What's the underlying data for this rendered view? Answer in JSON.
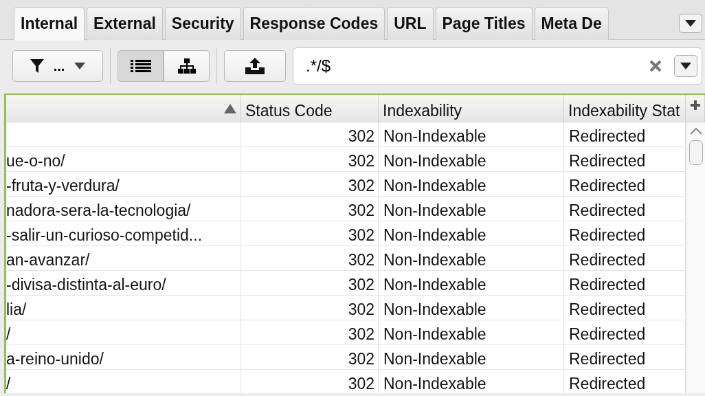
{
  "tabs": [
    {
      "label": "Internal",
      "selected": true
    },
    {
      "label": "External",
      "selected": false
    },
    {
      "label": "Security",
      "selected": false
    },
    {
      "label": "Response Codes",
      "selected": false
    },
    {
      "label": "URL",
      "selected": false
    },
    {
      "label": "Page Titles",
      "selected": false
    },
    {
      "label": "Meta De",
      "selected": false
    }
  ],
  "toolbar": {
    "filter_label": "...",
    "view_modes": [
      {
        "kind": "list",
        "selected": true
      },
      {
        "kind": "tree",
        "selected": false
      }
    ],
    "search": {
      "value": ".*/$"
    }
  },
  "table": {
    "columns": [
      {
        "sort_ascending": true
      },
      {
        "label": "Status Code"
      },
      {
        "label": "Indexability"
      },
      {
        "label": "Indexability Stat"
      }
    ],
    "rows": [
      {
        "status_code": "302",
        "indexability": "Non-Indexable",
        "indexability_status": "Redirected"
      },
      {
        "url": "ue-o-no/",
        "status_code": "302",
        "indexability": "Non-Indexable",
        "indexability_status": "Redirected"
      },
      {
        "url": "-fruta-y-verdura/",
        "status_code": "302",
        "indexability": "Non-Indexable",
        "indexability_status": "Redirected"
      },
      {
        "url": "nadora-sera-la-tecnologia/",
        "status_code": "302",
        "indexability": "Non-Indexable",
        "indexability_status": "Redirected"
      },
      {
        "url": "-salir-un-curioso-competid...",
        "status_code": "302",
        "indexability": "Non-Indexable",
        "indexability_status": "Redirected"
      },
      {
        "url": "an-avanzar/",
        "status_code": "302",
        "indexability": "Non-Indexable",
        "indexability_status": "Redirected"
      },
      {
        "url": "-divisa-distinta-al-euro/",
        "status_code": "302",
        "indexability": "Non-Indexable",
        "indexability_status": "Redirected"
      },
      {
        "url": "lia/",
        "status_code": "302",
        "indexability": "Non-Indexable",
        "indexability_status": "Redirected"
      },
      {
        "url": "/",
        "status_code": "302",
        "indexability": "Non-Indexable",
        "indexability_status": "Redirected"
      },
      {
        "url": "a-reino-unido/",
        "status_code": "302",
        "indexability": "Non-Indexable",
        "indexability_status": "Redirected"
      },
      {
        "url": "/",
        "status_code": "302",
        "indexability": "Non-Indexable",
        "indexability_status": "Redirected"
      }
    ]
  }
}
